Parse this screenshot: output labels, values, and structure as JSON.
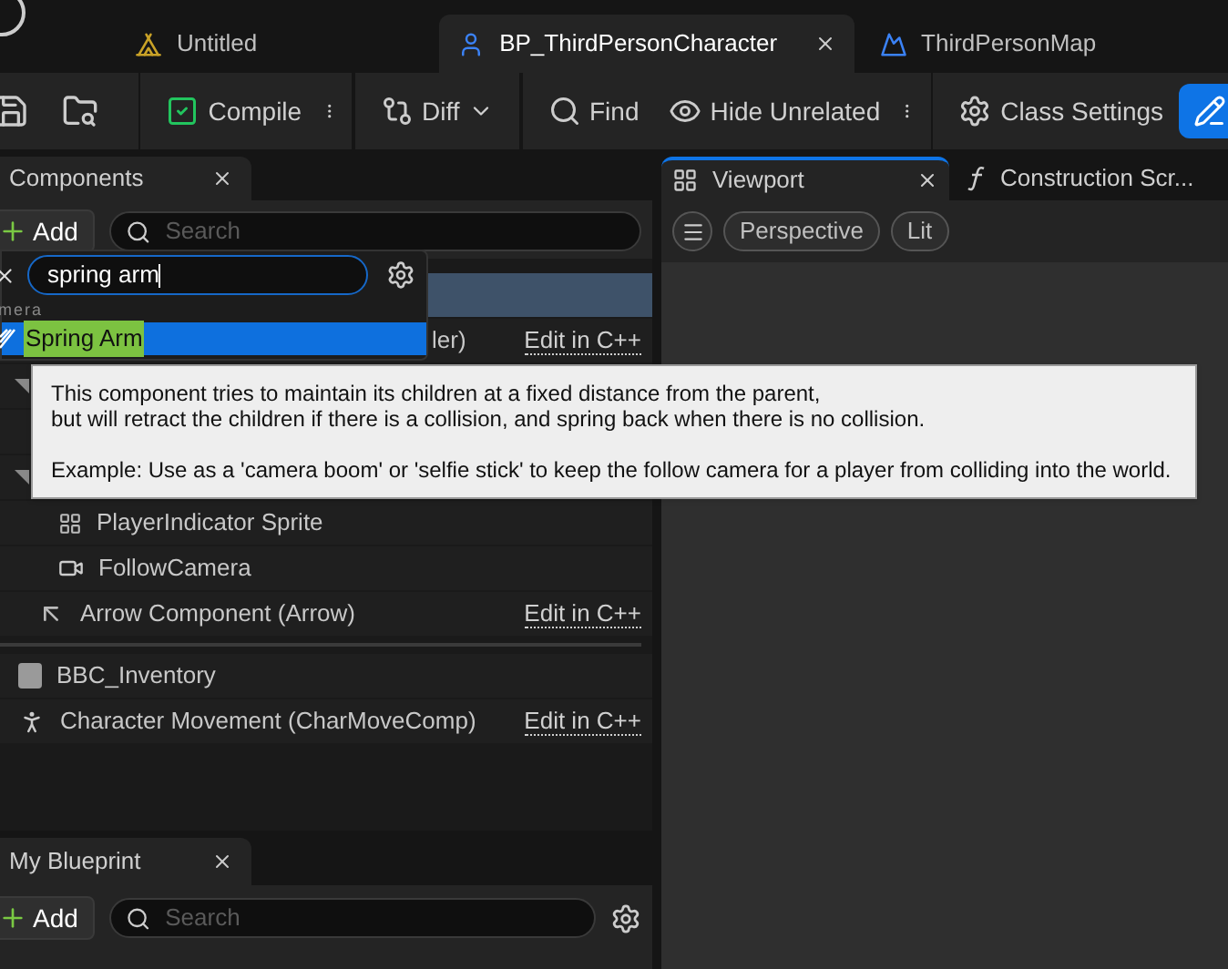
{
  "tabs": [
    {
      "label": "Untitled",
      "kind": "level",
      "selected": false,
      "closable": false
    },
    {
      "label": "BP_ThirdPersonCharacter",
      "kind": "person",
      "selected": true,
      "closable": true
    },
    {
      "label": "ThirdPersonMap",
      "kind": "map",
      "selected": false,
      "closable": false
    }
  ],
  "toolbar": [
    {
      "kind": "save"
    },
    {
      "kind": "browse"
    },
    {
      "kind": "separator"
    },
    {
      "kind": "compile",
      "label": "Compile"
    },
    {
      "kind": "more"
    },
    {
      "kind": "separator"
    },
    {
      "kind": "diff",
      "label": "Diff"
    },
    {
      "kind": "separator"
    },
    {
      "kind": "find",
      "label": "Find"
    },
    {
      "kind": "hide",
      "label": "Hide Unrelated"
    },
    {
      "kind": "more"
    },
    {
      "kind": "separator"
    },
    {
      "kind": "settings",
      "label": "Class Settings"
    },
    {
      "kind": "edit"
    }
  ],
  "components": {
    "title": "Components",
    "add": "Add",
    "search": {
      "placeholder": "Search"
    },
    "rows": [
      {
        "kind": "blank",
        "selected": true
      },
      {
        "kind": "partial",
        "label": "ler)",
        "link": "Edit in C++",
        "selected": false
      },
      {
        "kind": "group",
        "expanded": true,
        "selected": false
      },
      {
        "kind": "blank",
        "selected": false
      },
      {
        "kind": "group",
        "expanded": true,
        "selected": false
      },
      {
        "kind": "sprite",
        "label": "PlayerIndicator Sprite",
        "selected": false
      },
      {
        "kind": "camera",
        "label": "FollowCamera",
        "selected": false
      },
      {
        "kind": "arrow",
        "label": "Arrow Component (Arrow)",
        "link": "Edit in C++",
        "selected": false
      },
      {
        "kind": "divider"
      },
      {
        "kind": "inventory",
        "label": "BBC_Inventory",
        "selected": false
      },
      {
        "kind": "movement",
        "label": "Character Movement (CharMoveComp)",
        "link": "Edit in C++",
        "selected": false
      }
    ]
  },
  "add_menu": {
    "query": "spring arm",
    "category": "mera",
    "results": [
      {
        "label": "Spring Arm",
        "selected": true
      }
    ]
  },
  "tooltip": {
    "paragraphs": [
      [
        "This component tries to maintain its children at a fixed distance from the parent,",
        "but will retract the children if there is a collision, and spring back when there is no collision."
      ],
      [
        "Example: Use as a 'camera boom' or 'selfie stick' to keep the follow camera for a player from colliding into the world."
      ]
    ]
  },
  "viewport": {
    "tabs": [
      {
        "label": "Viewport",
        "kind": "viewport",
        "selected": true,
        "closable": true
      },
      {
        "label": "Construction Scr...",
        "kind": "function",
        "selected": false,
        "closable": false
      }
    ],
    "pills": [
      "Perspective",
      "Lit"
    ]
  },
  "my_blueprint": {
    "title": "My Blueprint",
    "add": "Add",
    "search": {
      "placeholder": "Search"
    }
  }
}
